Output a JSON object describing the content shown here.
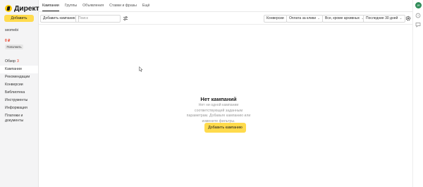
{
  "app": {
    "name": "Директ"
  },
  "sidebar": {
    "add_button": "Добавить",
    "account": "seomebi",
    "balance": "0 ₽",
    "topup_button": "Пополнить",
    "items": [
      {
        "label": "Обзор",
        "badge": "3"
      },
      {
        "label": "Кампании"
      },
      {
        "label": "Рекомендации"
      },
      {
        "label": "Конверсии"
      },
      {
        "label": "Библиотека"
      },
      {
        "label": "Инструменты"
      },
      {
        "label": "Информация"
      },
      {
        "label": "Платежи и документы"
      }
    ]
  },
  "tabs": [
    "Кампании",
    "Группы",
    "Объявления",
    "Ставки и фразы",
    "Ещё"
  ],
  "toolbar": {
    "add_campaign": "Добавить кампанию",
    "search_placeholder": "Поиск",
    "conversions": "Конверсии",
    "payment": "Оплата за клики",
    "any_strategy": "Все, кроме архивных",
    "period": "Последние 30 дней"
  },
  "empty": {
    "title": "Нет кампаний",
    "text": "Нет ни одной кампании соответствующей заданным параметрам. Добавьте кампанию или измените фильтры.",
    "button": "Добавить кампанию"
  },
  "rail": {
    "avatar": "JR"
  },
  "colors": {
    "accent": "#ffdb4d",
    "negative": "#e5341b"
  }
}
